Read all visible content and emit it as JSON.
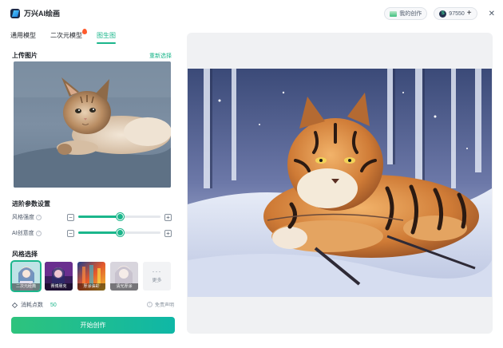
{
  "app": {
    "title": "万兴AI绘画"
  },
  "header": {
    "my_works_label": "我的创作",
    "credits": "97550",
    "add_label": "+",
    "close_label": "✕"
  },
  "tabs": [
    {
      "label": "通用模型",
      "active": false,
      "hot": false
    },
    {
      "label": "二次元模型",
      "active": false,
      "hot": true
    },
    {
      "label": "图生图",
      "active": true,
      "hot": false
    }
  ],
  "upload": {
    "title": "上传图片",
    "reselect_label": "重新选择",
    "image": "kitten-photo"
  },
  "params": {
    "title": "进阶参数设置",
    "items": [
      {
        "label": "风格强度",
        "value": 0.5,
        "minus": "−",
        "plus": "+"
      },
      {
        "label": "AI创意度",
        "value": 0.5,
        "minus": "−",
        "plus": "+"
      }
    ]
  },
  "styles": {
    "title": "风格选择",
    "items": [
      {
        "label": "二次元经典",
        "selected": true
      },
      {
        "label": "赛博朋克",
        "selected": false
      },
      {
        "label": "厚涂油彩",
        "selected": false
      },
      {
        "label": "清光厚涂",
        "selected": false
      }
    ],
    "more_label": "更多"
  },
  "cost": {
    "label": "消耗点数",
    "value": "50"
  },
  "disclaimer": {
    "label": "免责声明"
  },
  "start_button": {
    "label": "开始创作"
  },
  "result": {
    "image": "anime-tiger-in-snow"
  },
  "colors": {
    "accent": "#1bb68b",
    "hot": "#ff5a2c"
  }
}
